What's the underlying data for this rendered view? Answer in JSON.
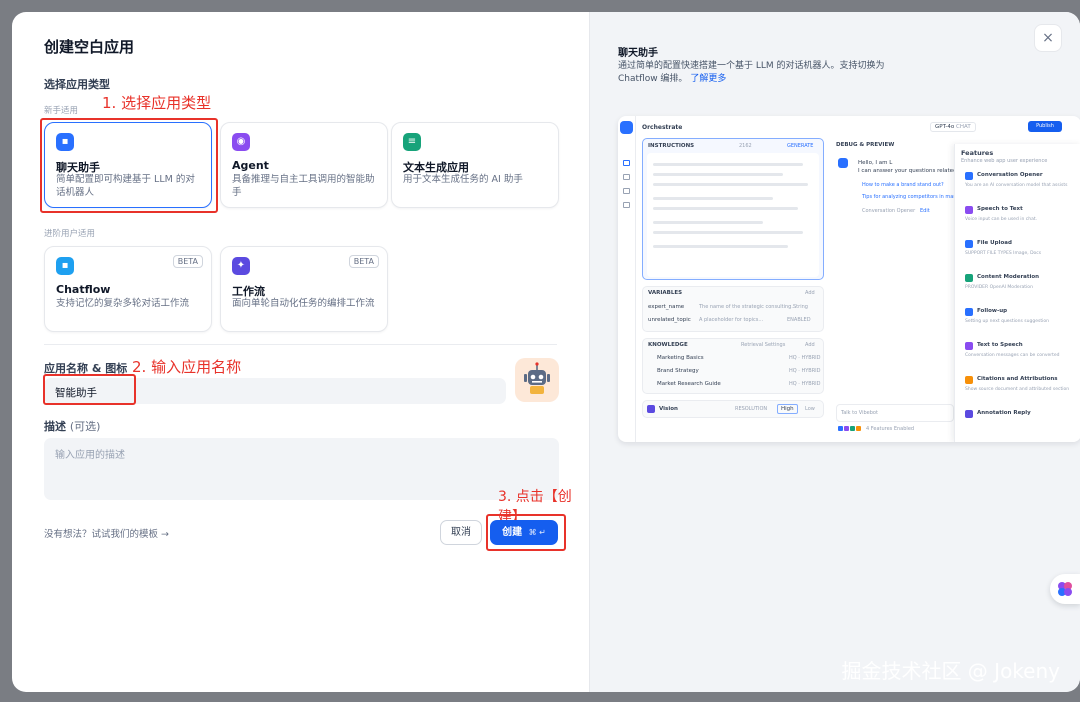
{
  "modal": {
    "title": "创建空白应用",
    "section_app_type": "选择应用类型",
    "beginner_label": "新手适用",
    "advanced_label": "进阶用户适用",
    "beginner_cards": [
      {
        "name": "聊天助手",
        "desc": "简单配置即可构建基于 LLM 的对话机器人",
        "icon": "chat-icon",
        "color": "#2970ff"
      },
      {
        "name": "Agent",
        "desc": "具备推理与自主工具调用的智能助手",
        "icon": "agent-icon",
        "color": "#8a4cf0"
      },
      {
        "name": "文本生成应用",
        "desc": "用于文本生成任务的 AI 助手",
        "icon": "text-gen-icon",
        "color": "#17a37a"
      }
    ],
    "advanced_cards": [
      {
        "name": "Chatflow",
        "desc": "支持记忆的复杂多轮对话工作流",
        "badge": "BETA",
        "icon": "chatflow-icon",
        "color": "#1ea0f0"
      },
      {
        "name": "工作流",
        "desc": "面向单轮自动化任务的编排工作流",
        "badge": "BETA",
        "icon": "workflow-icon",
        "color": "#5b4ae0"
      }
    ],
    "name_label": "应用名称 & 图标",
    "name_value": "智能助手",
    "desc_label": "描述",
    "desc_optional": "(可选)",
    "desc_placeholder": "输入应用的描述",
    "template_link": "没有想法？试试我们的模板 →",
    "cancel": "取消",
    "create": "创建",
    "create_shortcut": "⌘ ↵",
    "close": "×"
  },
  "annotations": {
    "step1": "1. 选择应用类型",
    "step2": "2. 输入应用名称",
    "step3": "3. 点击【创建】",
    "accent": "#e8322a"
  },
  "preview": {
    "title": "聊天助手",
    "desc_line1": "通过简单的配置快速搭建一个基于 LLM 的对话机器人。支持切换为",
    "desc_line2": "Chatflow 编排。",
    "learn_more": "了解更多",
    "app": {
      "header": "Orchestrate",
      "model": "GPT-4o",
      "model_mode": "CHAT",
      "publish": "Publish",
      "instructions": "INSTRUCTIONS",
      "instructions_count": "2162",
      "generate": "GENERATE",
      "debug": "DEBUG & PREVIEW",
      "greeting1": "Hello, I am L",
      "greeting2": "I can answer your questions related",
      "q1": "How to make a brand stand out?",
      "q2": "Tips for analyzing competitors in market",
      "opener": "Conversation Opener",
      "opener_edit": "Edit",
      "variables": "VARIABLES",
      "add": "Add",
      "variable_rows": [
        {
          "name": "expert_name",
          "desc": "The name of the strategic consulting...",
          "type": "String"
        },
        {
          "name": "unrelated_topic",
          "desc": "A placeholder for topics...",
          "type": "ENABLED"
        }
      ],
      "knowledge": "KNOWLEDGE",
      "retrieval": "Retrieval Settings",
      "knowledge_rows": [
        "Marketing Basics",
        "Brand Strategy",
        "Market Research Guide"
      ],
      "knowledge_tag": "HQ · HYBRID",
      "vision": "Vision",
      "resolution": "RESOLUTION",
      "high": "High",
      "low": "Low",
      "chat_placeholder": "Talk to Vibebot",
      "features_enabled": "4 Features Enabled",
      "features_title": "Features",
      "features_sub": "Enhance web app user experience",
      "features": [
        {
          "name": "Conversation Opener",
          "desc": "You are an AI conversation model that assists",
          "color": "#2970ff"
        },
        {
          "name": "Speech to Text",
          "desc": "Voice input can be used in chat.",
          "color": "#8a4cf0"
        },
        {
          "name": "File Upload",
          "desc": "SUPPORT FILE TYPES  Image, Docs",
          "color": "#2970ff"
        },
        {
          "name": "Content Moderation",
          "desc": "PROVIDER  OpenAI Moderation",
          "color": "#17a37a"
        },
        {
          "name": "Follow-up",
          "desc": "Setting up next questions suggestion",
          "color": "#2970ff"
        },
        {
          "name": "Text to Speech",
          "desc": "Conversation messages can be converted",
          "color": "#8a4cf0"
        },
        {
          "name": "Citations and Attributions",
          "desc": "Show source document and attributed section",
          "color": "#f79009"
        },
        {
          "name": "Annotation Reply",
          "desc": "",
          "color": "#5b4ae0"
        }
      ]
    }
  },
  "watermark": "掘金技术社区 @ Jokeny"
}
